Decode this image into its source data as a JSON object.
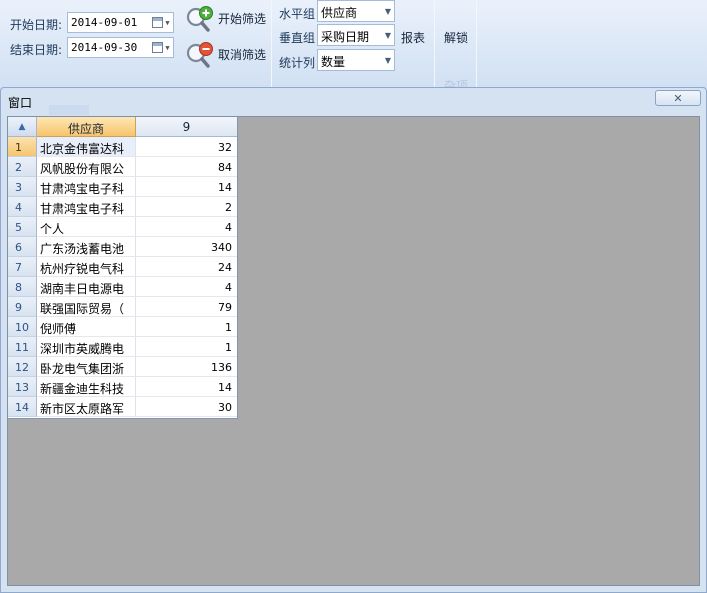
{
  "ribbon": {
    "start_date_label": "开始日期:",
    "start_date_value": "2014-09-01",
    "end_date_label": "结束日期:",
    "end_date_value": "2014-09-30",
    "start_filter_button": "开始筛选",
    "cancel_filter_button": "取消筛选",
    "horizontal_group_label": "水平组",
    "horizontal_group_value": "供应商",
    "vertical_group_label": "垂直组",
    "vertical_group_value": "采购日期",
    "stat_column_label": "统计列",
    "stat_column_value": "数量",
    "report_button": "报表",
    "unlock_button": "解锁",
    "misc_group_label": "杂项"
  },
  "window": {
    "title": "窗口",
    "close_glyph": "✕"
  },
  "grid": {
    "header_col1": "供应商",
    "header_col2": "9",
    "rows": [
      {
        "no": "1",
        "supplier": "北京金伟富达科",
        "value": "32"
      },
      {
        "no": "2",
        "supplier": "风帆股份有限公",
        "value": "84"
      },
      {
        "no": "3",
        "supplier": "甘肃鸿宝电子科",
        "value": "14"
      },
      {
        "no": "4",
        "supplier": "甘肃鸿宝电子科",
        "value": "2"
      },
      {
        "no": "5",
        "supplier": "个人",
        "value": "4"
      },
      {
        "no": "6",
        "supplier": "广东汤浅蓄电池",
        "value": "340"
      },
      {
        "no": "7",
        "supplier": "杭州疗锐电气科",
        "value": "24"
      },
      {
        "no": "8",
        "supplier": "湖南丰日电源电",
        "value": "4"
      },
      {
        "no": "9",
        "supplier": "联强国际贸易（",
        "value": "79"
      },
      {
        "no": "10",
        "supplier": "倪师傅",
        "value": "1"
      },
      {
        "no": "11",
        "supplier": "深圳市英威腾电",
        "value": "1"
      },
      {
        "no": "12",
        "supplier": "卧龙电气集团浙",
        "value": "136"
      },
      {
        "no": "13",
        "supplier": "新疆金迪生科技",
        "value": "14"
      },
      {
        "no": "14",
        "supplier": "新市区太原路军",
        "value": "30"
      }
    ]
  },
  "colors": {
    "ribbon_bg": "#dbe7f6",
    "selected_header": "#f7c46a",
    "client_bg": "#a9a9a9"
  }
}
